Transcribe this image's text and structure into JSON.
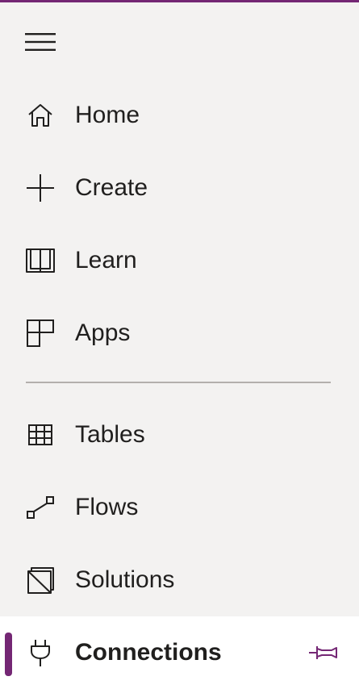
{
  "colors": {
    "accent": "#742774",
    "background": "#f3f2f1",
    "selected_background": "#ffffff",
    "text": "#201f1e",
    "divider": "#b3b0ad"
  },
  "menu": {
    "icon": "hamburger-menu-icon"
  },
  "nav": {
    "items": [
      {
        "label": "Home",
        "icon": "home-icon"
      },
      {
        "label": "Create",
        "icon": "plus-icon"
      },
      {
        "label": "Learn",
        "icon": "book-icon"
      },
      {
        "label": "Apps",
        "icon": "apps-icon"
      }
    ],
    "items_2": [
      {
        "label": "Tables",
        "icon": "table-icon"
      },
      {
        "label": "Flows",
        "icon": "flow-icon"
      },
      {
        "label": "Solutions",
        "icon": "solutions-icon"
      },
      {
        "label": "Connections",
        "icon": "plug-icon",
        "selected": true,
        "pin_icon": "pin-icon"
      }
    ]
  }
}
